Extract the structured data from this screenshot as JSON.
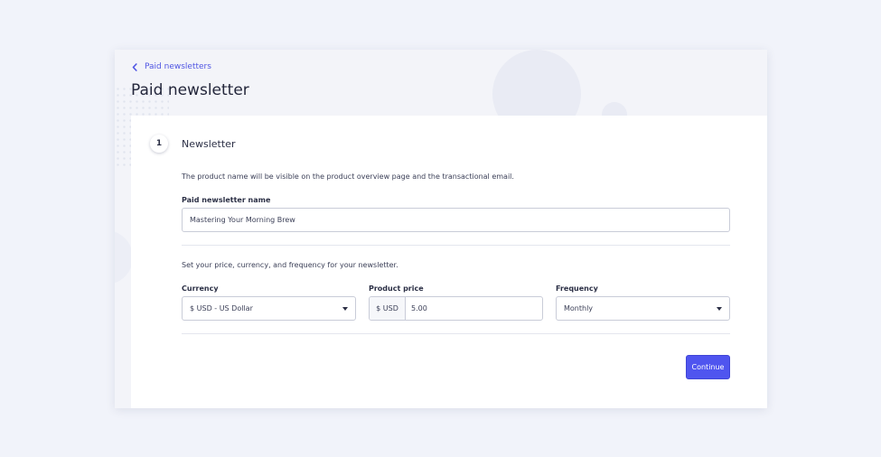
{
  "breadcrumb": {
    "label": "Paid newsletters",
    "icon": "chevron-left-icon"
  },
  "page": {
    "title": "Paid newsletter"
  },
  "step": {
    "number": "1",
    "title": "Newsletter",
    "name_section": {
      "description": "The product name will be visible on the product overview page and the transactional email.",
      "name_label": "Paid newsletter name",
      "name_value": "Mastering Your Morning Brew"
    },
    "pricing_section": {
      "description": "Set your price, currency, and frequency for your newsletter.",
      "currency_label": "Currency",
      "currency_value": "$ USD - US Dollar",
      "price_label": "Product price",
      "price_prefix": "$ USD",
      "price_value": "5.00",
      "frequency_label": "Frequency",
      "frequency_value": "Monthly"
    },
    "continue_label": "Continue"
  },
  "colors": {
    "accent": "#4f55ef",
    "background": "#f1f3fa"
  }
}
